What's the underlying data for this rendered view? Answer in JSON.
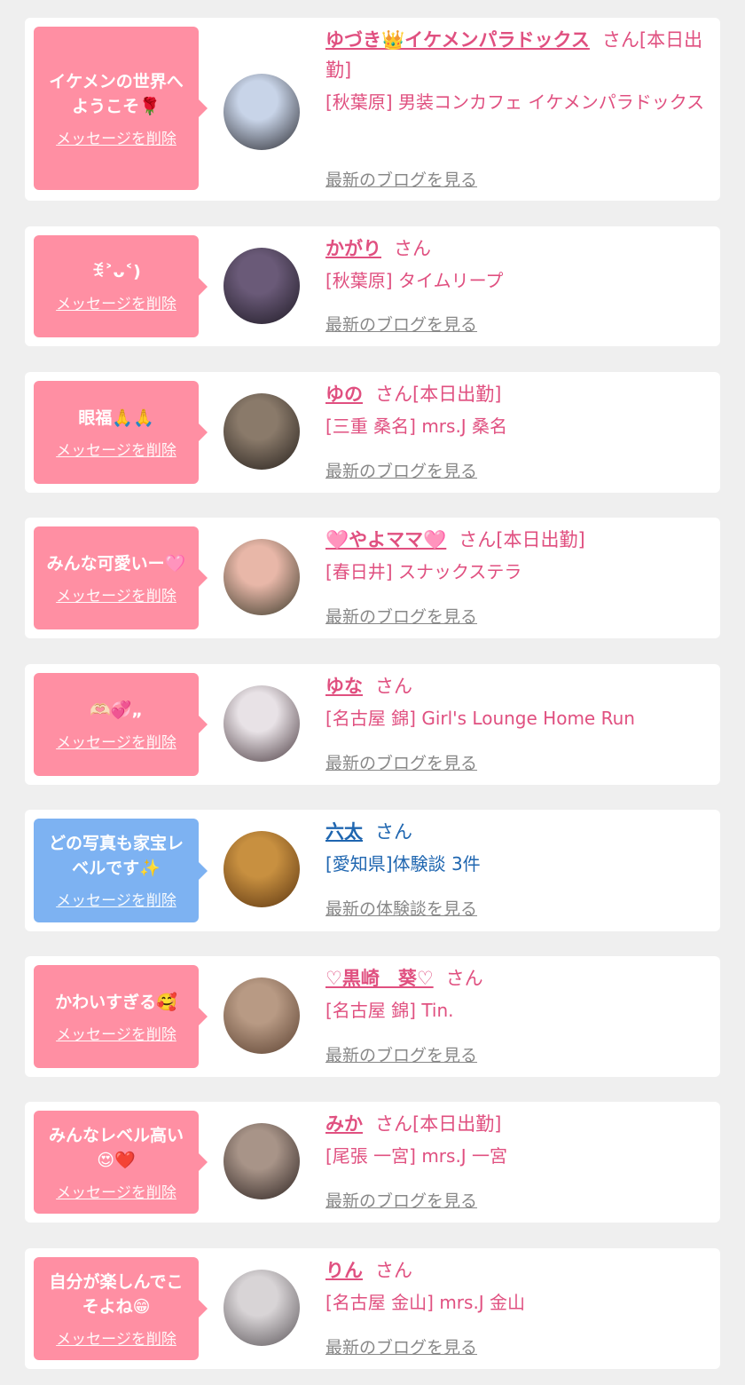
{
  "delete_label": "メッセージを削除",
  "entries": [
    {
      "message": "イケメンの世界へ\nようこそ🌹",
      "name": "ゆづき👑イケメンパラドックス",
      "suffix": "さん[本日出勤]",
      "shop": "[秋葉原] 男装コンカフェ イケメンパラドックス",
      "link": "最新のブログを見る",
      "theme": "pink",
      "avatar_colors": [
        "#c8d4e8",
        "#2a2a30"
      ]
    },
    {
      "message": "ꉂ˃ᴗ˂)",
      "name": "かがり",
      "suffix": "さん",
      "shop": "[秋葉原] タイムリープ",
      "link": "最新のブログを見る",
      "theme": "pink",
      "avatar_colors": [
        "#6a5a78",
        "#1e1a24"
      ]
    },
    {
      "message": "眼福🙏🙏",
      "name": "ゆの",
      "suffix": "さん[本日出勤]",
      "shop": "[三重 桑名] mrs.J 桑名",
      "link": "最新のブログを見る",
      "theme": "pink",
      "avatar_colors": [
        "#8a7a6a",
        "#26201c"
      ]
    },
    {
      "message": "みんな可愛いー🩷",
      "name": "🩷やよママ🩷",
      "suffix": "さん[本日出勤]",
      "shop": "[春日井] スナックステラ",
      "link": "最新のブログを見る",
      "theme": "pink",
      "avatar_colors": [
        "#e8b7a8",
        "#3a3a2a"
      ]
    },
    {
      "message": "🫶🏻💞„",
      "name": "ゆな",
      "suffix": "さん",
      "shop": "[名古屋 錦] Girl's Lounge Home Run",
      "link": "最新のブログを見る",
      "theme": "pink",
      "avatar_colors": [
        "#e8e2e6",
        "#4a3a40"
      ]
    },
    {
      "message": "どの写真も家宝レ\nベルです✨",
      "name": "六太",
      "suffix": "さん",
      "shop": "[愛知県]体験談 3件",
      "link": "最新の体験談を見る",
      "theme": "blue",
      "avatar_colors": [
        "#c89040",
        "#5a3410"
      ]
    },
    {
      "message": "かわいすぎる🥰",
      "name": "♡黒崎　葵♡",
      "suffix": "さん",
      "shop": "[名古屋 錦] Tin.",
      "link": "最新のブログを見る",
      "theme": "pink",
      "avatar_colors": [
        "#b89a84",
        "#5a4030"
      ]
    },
    {
      "message": "みんなレベル高い\n😍❤️",
      "name": "みか",
      "suffix": "さん[本日出勤]",
      "shop": "[尾張 一宮] mrs.J 一宮",
      "link": "最新のブログを見る",
      "theme": "pink",
      "avatar_colors": [
        "#a89488",
        "#2c2220"
      ]
    },
    {
      "message": "自分が楽しんでこ\nそよね😁",
      "name": "りん",
      "suffix": "さん",
      "shop": "[名古屋 金山] mrs.J 金山",
      "link": "最新のブログを見る",
      "theme": "pink",
      "avatar_colors": [
        "#d8d4d6",
        "#5a5458"
      ]
    }
  ]
}
